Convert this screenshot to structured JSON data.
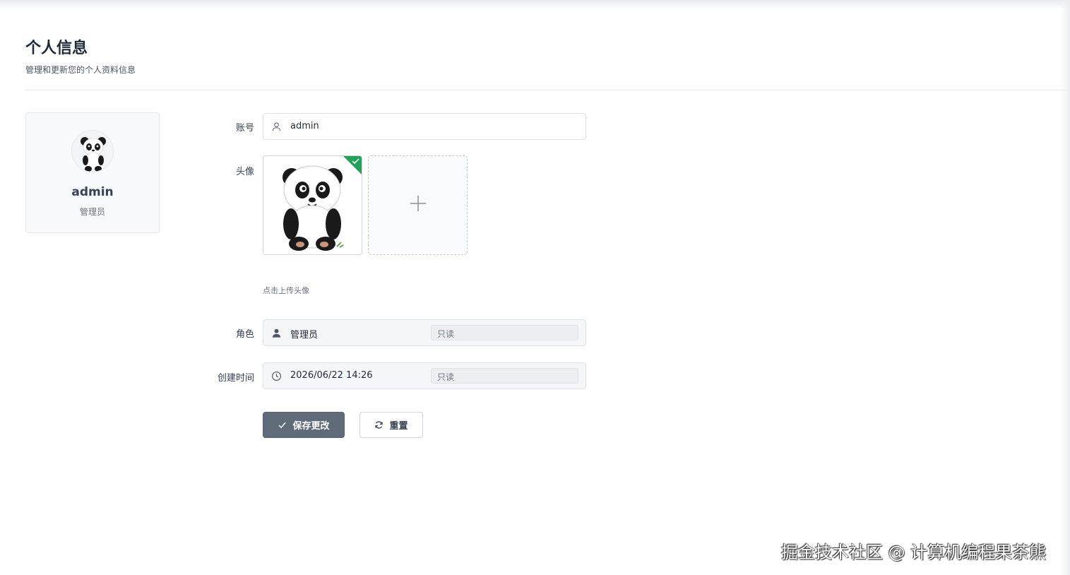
{
  "header": {
    "title": "个人信息",
    "subtitle": "管理和更新您的个人资料信息"
  },
  "profile_card": {
    "name": "admin",
    "role": "管理员"
  },
  "form": {
    "account": {
      "label": "账号",
      "value": "admin",
      "icon": "user-outline-icon"
    },
    "avatar": {
      "label": "头像",
      "hint": "点击上传头像",
      "add_icon": "plus-icon",
      "status_icon": "check-icon"
    },
    "role": {
      "label": "角色",
      "value": "管理员",
      "readonly_tag": "只读",
      "icon": "user-filled-icon"
    },
    "created_time": {
      "label": "创建时间",
      "value": "2026/06/22 14:26",
      "readonly_tag": "只读",
      "icon": "clock-icon"
    }
  },
  "actions": {
    "save_label": "保存更改",
    "reset_label": "重置"
  },
  "watermark": "掘金技术社区 @ 计算机编程果茶熊",
  "colors": {
    "primary_button": "#5f6b78",
    "success_corner": "#1ea45a",
    "border": "#dcdfe3"
  }
}
